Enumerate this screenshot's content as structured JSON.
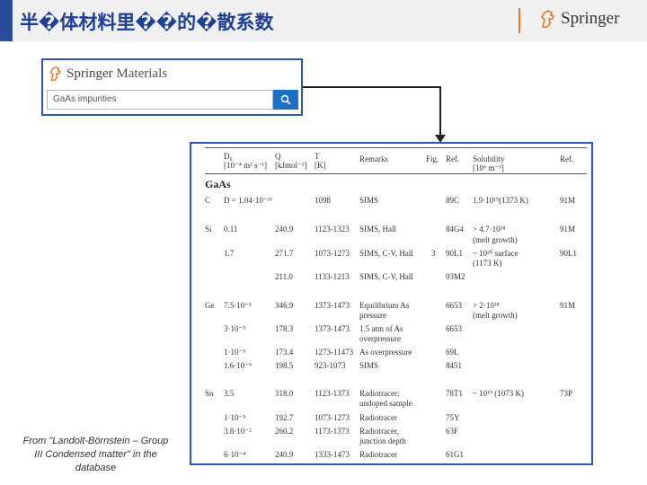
{
  "header": {
    "title": "半�体材料里��的�散系数",
    "brand": "Springer",
    "accent_color": "#2b4b9b",
    "divider_color": "#e07a2a"
  },
  "search_widget": {
    "brand_a": "Springer",
    "brand_b": "Materials",
    "query": "GaAs impurities",
    "button_icon": "search-icon",
    "border_color": "#2c57b0"
  },
  "table": {
    "headers": {
      "d0": "D₀",
      "d0_unit": "[10⁻⁴ m² s⁻¹]",
      "q": "Q",
      "q_unit": "[kJmol⁻¹]",
      "t": "T",
      "t_unit": "[K]",
      "remarks": "Remarks",
      "fig": "Fig.",
      "ref": "Ref.",
      "solubility": "Solubility",
      "sol_unit": "[10⁶ m⁻³]",
      "ref2": "Ref."
    },
    "section": "GaAs",
    "rows": [
      {
        "el": "C",
        "d0": "D = 1.04·10⁻¹⁶",
        "q": "",
        "t": "1098",
        "remarks": "SIMS",
        "fig": "",
        "ref": "89C",
        "sol": "1.9·10¹⁹(1373 K)",
        "ref2": "91M"
      },
      {
        "el": "Si",
        "d0": "0.11",
        "q": "240.9",
        "t": "1123-1323",
        "remarks": "SIMS, Hall",
        "fig": "",
        "ref": "84G4",
        "sol": "> 4.7·10¹⁸",
        "ref2": "91M"
      },
      {
        "el": "",
        "d0": "",
        "q": "",
        "t": "",
        "remarks": "",
        "fig": "",
        "ref": "",
        "sol": "(melt growth)",
        "ref2": ""
      },
      {
        "el": "",
        "d0": "1.7",
        "q": "271.7",
        "t": "1073-1273",
        "remarks": "SIMS, C-V, Hall",
        "fig": "3",
        "ref": "90L1",
        "sol": "~ 10²⁰ surface",
        "ref2": "90L1"
      },
      {
        "el": "",
        "d0": "",
        "q": "",
        "t": "",
        "remarks": "",
        "fig": "",
        "ref": "",
        "sol": "(1173 K)",
        "ref2": ""
      },
      {
        "el": "",
        "d0": "",
        "q": "211.0",
        "t": "1133-1213",
        "remarks": "SIMS, C-V, Hall",
        "fig": "",
        "ref": "93M2",
        "sol": "",
        "ref2": ""
      },
      {
        "el": "Ge",
        "d0": "7.5·10⁻³",
        "q": "346.9",
        "t": "1373-1473",
        "remarks": "Equilibrium As",
        "fig": "",
        "ref": "6653",
        "sol": "> 2·10¹⁸",
        "ref2": "91M"
      },
      {
        "el": "",
        "d0": "",
        "q": "",
        "t": "",
        "remarks": "pressure",
        "fig": "",
        "ref": "",
        "sol": "(melt growth)",
        "ref2": ""
      },
      {
        "el": "",
        "d0": "3·10⁻⁵",
        "q": "178.3",
        "t": "1373-1473",
        "remarks": "1.5 atm of As",
        "fig": "",
        "ref": "6653",
        "sol": "",
        "ref2": ""
      },
      {
        "el": "",
        "d0": "",
        "q": "",
        "t": "",
        "remarks": "overpressure",
        "fig": "",
        "ref": "",
        "sol": "",
        "ref2": ""
      },
      {
        "el": "",
        "d0": "1·10⁻⁵",
        "q": "173.4",
        "t": "1273-11473",
        "remarks": "As overpressure",
        "fig": "",
        "ref": "69L",
        "sol": "",
        "ref2": ""
      },
      {
        "el": "",
        "d0": "1.6·10⁻⁵",
        "q": "198.5",
        "t": "923-1073",
        "remarks": "SIMS",
        "fig": "",
        "ref": "8451",
        "sol": "",
        "ref2": ""
      },
      {
        "el": "Sn",
        "d0": "3.5",
        "q": "318.0",
        "t": "1123-1373",
        "remarks": "Radiotracer;",
        "fig": "",
        "ref": "78T1",
        "sol": "~ 10¹⁹ (1073 K)",
        "ref2": "73P"
      },
      {
        "el": "",
        "d0": "",
        "q": "",
        "t": "",
        "remarks": "undoped sample",
        "fig": "",
        "ref": "",
        "sol": "",
        "ref2": ""
      },
      {
        "el": "",
        "d0": "1·10⁻⁵",
        "q": "192.7",
        "t": "1073-1273",
        "remarks": "Radiotracer",
        "fig": "",
        "ref": "75Y",
        "sol": "",
        "ref2": ""
      },
      {
        "el": "",
        "d0": "3.8·10⁻²",
        "q": "260.2",
        "t": "1173-1373",
        "remarks": "Radiotracer,",
        "fig": "",
        "ref": "63F",
        "sol": "",
        "ref2": ""
      },
      {
        "el": "",
        "d0": "",
        "q": "",
        "t": "",
        "remarks": "junction depth",
        "fig": "",
        "ref": "",
        "sol": "",
        "ref2": ""
      },
      {
        "el": "",
        "d0": "6·10⁻⁴",
        "q": "240.9",
        "t": "1333-1473",
        "remarks": "Radiotracer",
        "fig": "",
        "ref": "61G1",
        "sol": "",
        "ref2": ""
      }
    ]
  },
  "caption": "From \"Landolt-Börnstein – Group III Condensed matter\" in the database"
}
